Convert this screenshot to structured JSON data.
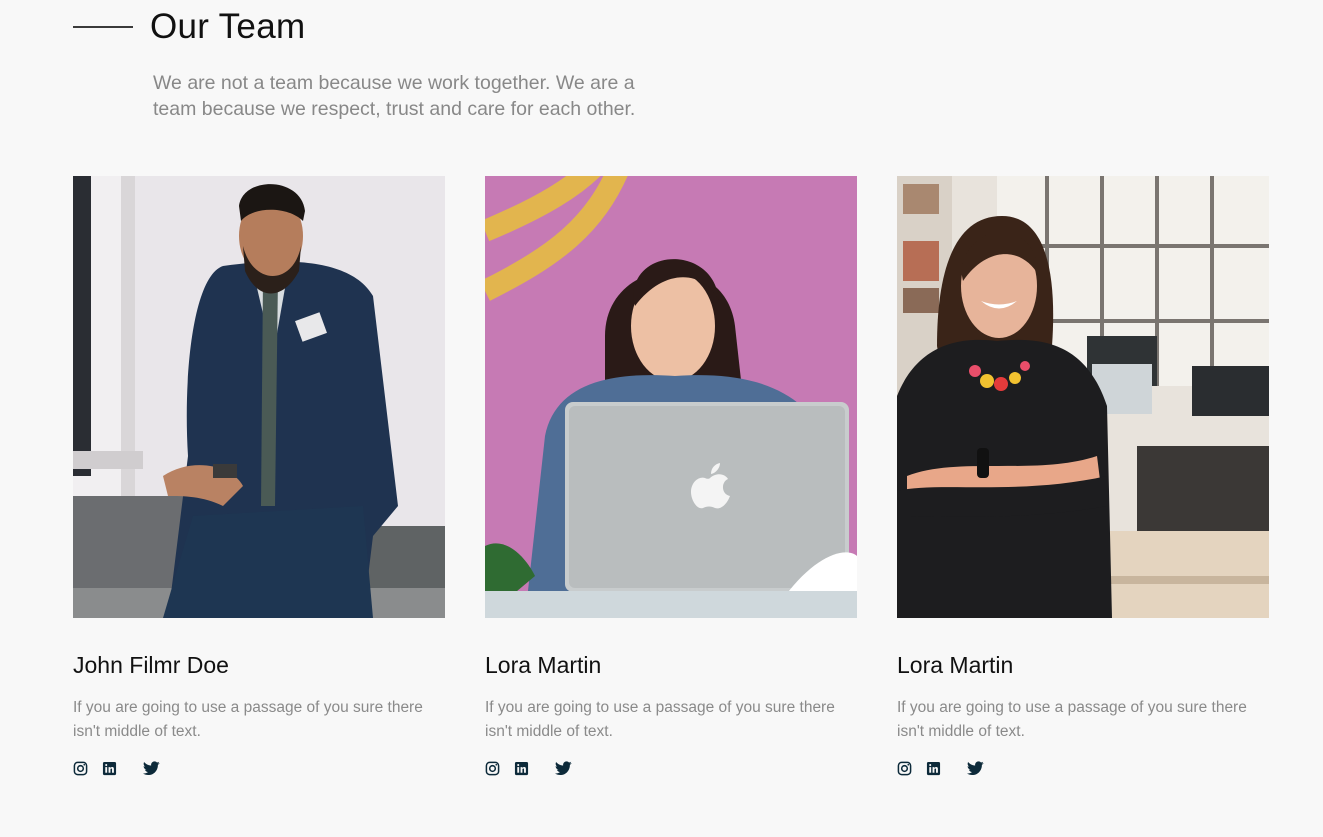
{
  "section": {
    "title": "Our Team",
    "intro": "We are not a team because we work together. We are a team because we respect, trust and care for each other."
  },
  "team": [
    {
      "name": "John Filmr Doe",
      "description": "If you are going to use a passage of you sure there isn't middle of text.",
      "socials": [
        "instagram-icon",
        "linkedin-icon",
        "twitter-icon"
      ]
    },
    {
      "name": "Lora Martin",
      "description": "If you are going to use a passage of you sure there isn't middle of text.",
      "socials": [
        "instagram-icon",
        "linkedin-icon",
        "twitter-icon"
      ]
    },
    {
      "name": "Lora Martin",
      "description": "If you are going to use a passage of you sure there isn't middle of text.",
      "socials": [
        "instagram-icon",
        "linkedin-icon",
        "twitter-icon"
      ]
    }
  ],
  "colors": {
    "background": "#f8f8f8",
    "icon": "#0d2a3a",
    "muted_text": "#888888"
  }
}
